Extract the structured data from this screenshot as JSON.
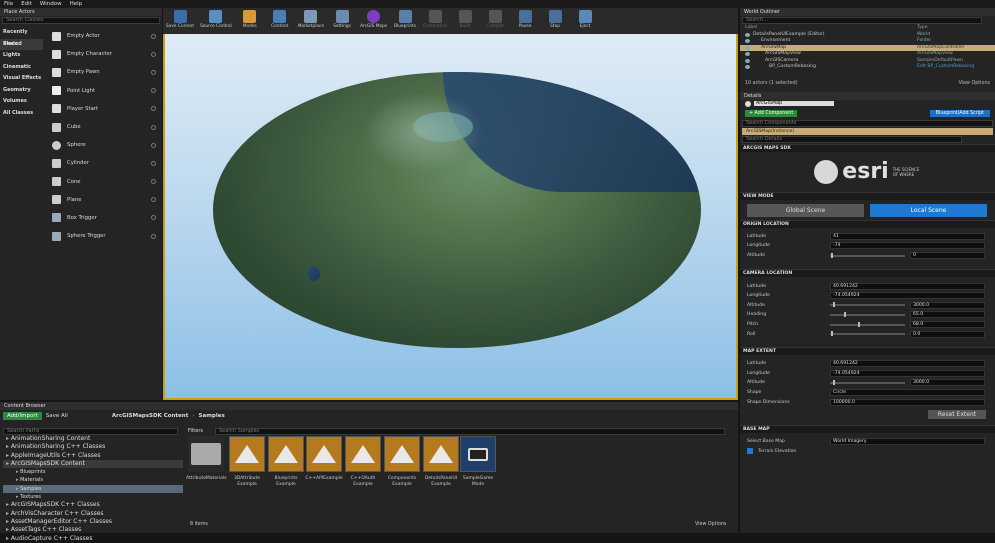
{
  "menu": [
    "File",
    "Edit",
    "Window",
    "Help"
  ],
  "place_actors": {
    "tab": "Place Actors",
    "search_placeholder": "Search Classes",
    "categories": [
      "Recently Placed",
      "Basic",
      "Lights",
      "Cinematic",
      "Visual Effects",
      "Geometry",
      "Volumes",
      "All Classes"
    ],
    "actors": [
      "Empty Actor",
      "Empty Character",
      "Empty Pawn",
      "Point Light",
      "Player Start",
      "Cube",
      "Sphere",
      "Cylinder",
      "Cone",
      "Plane",
      "Box Trigger",
      "Sphere Trigger"
    ]
  },
  "toolbar": [
    "Save Current",
    "Source Control",
    "Modes",
    "Content",
    "Marketplace",
    "Settings",
    "ArcGIS Maps",
    "Blueprints",
    "Cinematics",
    "Build",
    "Compile",
    "Pause",
    "Stop",
    "Eject"
  ],
  "outliner": {
    "tab": "World Outliner",
    "search_placeholder": "Search...",
    "col_label": "Label",
    "col_type": "Type",
    "rows": [
      {
        "label": "DetailsPanelUIExample (Editor)",
        "type": "World"
      },
      {
        "label": "Environment",
        "type": "Folder"
      },
      {
        "label": "ArcGISMap",
        "type": "ArcGISMapController"
      },
      {
        "label": "ArcGISMapView",
        "type": "ArcGISMapView"
      },
      {
        "label": "ArcGISCamera",
        "type": "SampleDefaultPawn"
      },
      {
        "label": "BP_CustomRebasing",
        "type": "Edit BP_CustomRebasing"
      }
    ],
    "status": "10 actors (1 selected)",
    "view_options": "View Options"
  },
  "details": {
    "tab": "Details",
    "name": "ArcGISMap",
    "add_component": "+ Add Component",
    "blueprint": "Blueprint/Add Script",
    "search_components": "Search Components",
    "instance": "ArcGISMap(Instance)",
    "search_details": "Search Details",
    "sdk_header": "ARCGIS MAPS SDK",
    "logo_text": "esri",
    "logo_tag": "THE SCIENCE OF WHERE",
    "view_mode_header": "VIEW MODE",
    "global_scene": "Global Scene",
    "local_scene": "Local Scene",
    "origin_header": "ORIGIN LOCATION",
    "origin": {
      "lat_label": "Latitude",
      "lat": "41",
      "lon_label": "Longitude",
      "lon": "-74",
      "alt_label": "Altitude",
      "alt": "0"
    },
    "camera_header": "CAMERA LOCATION",
    "camera": {
      "lat_label": "Latitude",
      "lat": "40.691242",
      "lon_label": "Longitude",
      "lon": "-74.054924",
      "alt_label": "Altitude",
      "alt": "3000.0",
      "heading_label": "Heading",
      "heading": "65.0",
      "pitch_label": "Pitch",
      "pitch": "68.0",
      "roll_label": "Roll",
      "roll": "0.0"
    },
    "extent_header": "MAP EXTENT",
    "extent": {
      "lat_label": "Latitude",
      "lat": "40.691242",
      "lon_label": "Longitude",
      "lon": "-74.054924",
      "alt_label": "Altitude",
      "alt": "3000.0",
      "shape_label": "Shape",
      "shape": "Circle",
      "dim_label": "Shape Dimensions",
      "dim": "100000.0",
      "reset": "Reset Extent"
    },
    "basemap_header": "BASE MAP",
    "basemap_label": "Select Base Map",
    "basemap": "World Imagery",
    "terrain": "Terrain Elevation"
  },
  "content_browser": {
    "tab": "Content Browser",
    "add_import": "Add/Import",
    "save_all": "Save All",
    "breadcrumb": [
      "ArcGISMapsSDK Content",
      "Samples"
    ],
    "search_paths": "Search Paths",
    "filters": "Filters",
    "search_samples": "Search Samples",
    "tree": [
      "AnimationSharing Content",
      "AnimationSharing C++ Classes",
      "AppleImageUtils C++ Classes",
      "ArcGISMapsSDK Content",
      "Blueprints",
      "Materials",
      "Samples",
      "Textures",
      "ArcGISMapsSDK C++ Classes",
      "ArchVisCharacter C++ Classes",
      "AssetManagerEditor C++ Classes",
      "AssetTags C++ Classes",
      "AudioCapture C++ Classes"
    ],
    "assets": [
      "AttributeMaterials",
      "3DAttribute Example",
      "Blueprints Example",
      "C++APIExample",
      "C++OAuth Example",
      "Components Example",
      "DetailsPanelUI Example",
      "SampleGame Mode"
    ],
    "count": "8 items",
    "view_options": "View Options"
  }
}
